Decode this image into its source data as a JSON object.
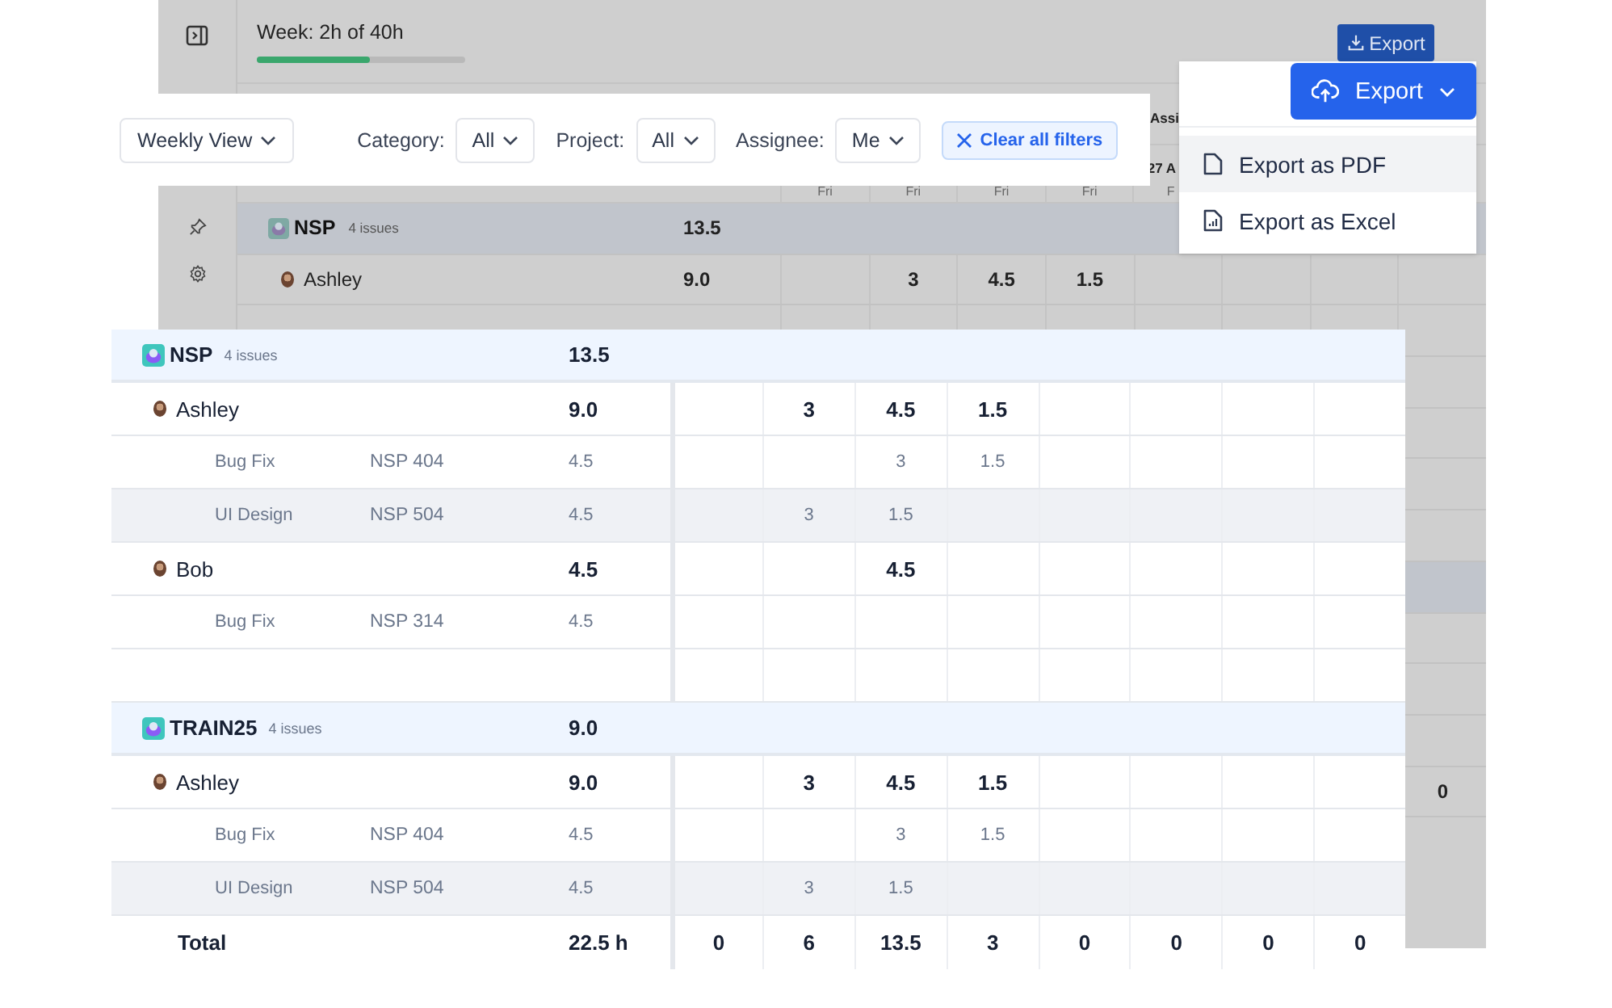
{
  "background_app": {
    "week_label": "Week: 2h of 40h",
    "week_progress": {
      "level": 0.54
    },
    "export_button": "Export",
    "header_label": "Assi",
    "date_label": "27 A",
    "day_labels": [
      "Fri",
      "Fri",
      "Fri",
      "Fri",
      "F"
    ],
    "rows": [
      {
        "kind": "group",
        "name": "NSP",
        "count": "4 issues",
        "total": "13.5"
      },
      {
        "kind": "person",
        "name": "Ashley",
        "total": "9.0",
        "days": {
          "col_2": "3",
          "col_3": "4.5",
          "col_4": "1.5"
        }
      },
      {
        "kind": "task"
      },
      {
        "kind": "task"
      },
      {
        "kind": "person"
      },
      {
        "kind": "task"
      },
      {
        "kind": "blank"
      },
      {
        "kind": "group"
      },
      {
        "kind": "person"
      },
      {
        "kind": "task"
      },
      {
        "kind": "task"
      },
      {
        "kind": "total",
        "days": {
          "col_8": "0"
        }
      }
    ]
  },
  "filter_bar": {
    "view": "Weekly View",
    "filters": [
      {
        "label": "Category:",
        "value": "All"
      },
      {
        "label": "Project:",
        "value": "All"
      },
      {
        "label": "Assignee:",
        "value": "Me"
      }
    ],
    "clear": "Clear all filters"
  },
  "export_menu": {
    "button": "Export",
    "items": [
      {
        "label": "Export as PDF",
        "kind": "pdf",
        "selected": true
      },
      {
        "label": "Export as Excel",
        "kind": "excel",
        "selected": false
      }
    ]
  },
  "table": {
    "rows": [
      {
        "kind": "group",
        "name": "NSP",
        "count": "4 issues",
        "total": "13.5"
      },
      {
        "kind": "person",
        "name": "Ashley",
        "total": "9.0",
        "days": {
          "col_2": "3",
          "col_3": "4.5",
          "col_4": "1.5"
        }
      },
      {
        "kind": "task",
        "type": "Bug Fix",
        "key": "NSP 404",
        "total": "4.5",
        "striped": false,
        "days": {
          "col_3": "3",
          "col_4": "1.5"
        }
      },
      {
        "kind": "task",
        "type": "UI Design",
        "key": "NSP 504",
        "total": "4.5",
        "striped": true,
        "days": {
          "col_2": "3",
          "col_3": "1.5"
        }
      },
      {
        "kind": "person",
        "name": "Bob",
        "total": "4.5",
        "days": {
          "col_3": "4.5"
        }
      },
      {
        "kind": "task",
        "type": "Bug Fix",
        "key": "NSP 314",
        "total": "4.5",
        "striped": false
      },
      {
        "kind": "blank"
      },
      {
        "kind": "group",
        "name": "TRAIN25",
        "count": "4 issues",
        "total": "9.0"
      },
      {
        "kind": "person",
        "name": "Ashley",
        "total": "9.0",
        "days": {
          "col_2": "3",
          "col_3": "4.5",
          "col_4": "1.5"
        }
      },
      {
        "kind": "task",
        "type": "Bug Fix",
        "key": "NSP 404",
        "total": "4.5",
        "striped": false,
        "days": {
          "col_3": "3",
          "col_4": "1.5"
        }
      },
      {
        "kind": "task",
        "type": "UI Design",
        "key": "NSP 504",
        "total": "4.5",
        "striped": true,
        "days": {
          "col_2": "3",
          "col_3": "1.5"
        }
      },
      {
        "kind": "total",
        "label": "Total",
        "total": "22.5 h",
        "days": {
          "col_1": "0",
          "col_2": "6",
          "col_3": "13.5",
          "col_4": "3",
          "col_5": "0",
          "col_6": "0",
          "col_7": "0",
          "col_8": "0"
        }
      }
    ]
  }
}
